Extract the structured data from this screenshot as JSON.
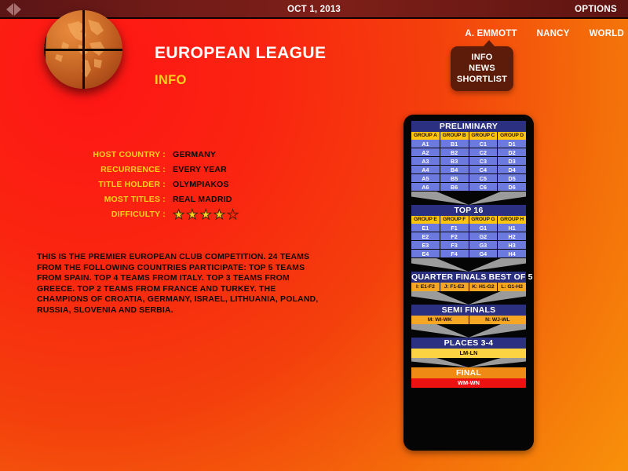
{
  "topbar": {
    "date": "OCT 1, 2013",
    "options_label": "OPTIONS",
    "back_icon": "triangle-left-icon",
    "forward_icon": "triangle-right-icon"
  },
  "logo": {
    "icon": "basketball-globe-logo"
  },
  "header": {
    "title": "EUROPEAN LEAGUE",
    "subtitle": "INFO"
  },
  "usernav": {
    "items": [
      {
        "label": "A. EMMOTT",
        "active": true
      },
      {
        "label": "NANCY",
        "active": false
      },
      {
        "label": "WORLD",
        "active": false
      }
    ]
  },
  "dropdown": {
    "items": [
      {
        "label": "INFO"
      },
      {
        "label": "NEWS"
      },
      {
        "label": "SHORTLIST"
      }
    ]
  },
  "info_fields": [
    {
      "label": "HOST COUNTRY :",
      "value": "GERMANY"
    },
    {
      "label": "RECURRENCE :",
      "value": "EVERY YEAR"
    },
    {
      "label": "TITLE HOLDER :",
      "value": "OLYMPIAKOS"
    },
    {
      "label": "MOST TITLES :",
      "value": "REAL MADRID"
    }
  ],
  "difficulty": {
    "label": "DIFFICULTY :",
    "filled": 4,
    "total": 5,
    "filled_glyph": "★",
    "empty_glyph": "★"
  },
  "description": "THIS IS THE PREMIER EUROPEAN CLUB COMPETITION.  24 TEAMS FROM THE FOLLOWING COUNTRIES PARTICIPATE: TOP 5 TEAMS FROM SPAIN.  TOP 4 TEAMS FROM ITALY.  TOP 3 TEAMS FROM GREECE.  TOP 2 TEAMS FROM FRANCE AND TURKEY.  THE CHAMPIONS OF CROATIA, GERMANY, ISRAEL, LITHUANIA, POLAND, RUSSIA, SLOVENIA AND SERBIA.",
  "bracket": {
    "preliminary": {
      "title": "PRELIMINARY",
      "group_headers": [
        "GROUP A",
        "GROUP B",
        "GROUP C",
        "GROUP D"
      ],
      "rows": [
        [
          "A1",
          "B1",
          "C1",
          "D1"
        ],
        [
          "A2",
          "B2",
          "C2",
          "D2"
        ],
        [
          "A3",
          "B3",
          "C3",
          "D3"
        ],
        [
          "A4",
          "B4",
          "C4",
          "D4"
        ],
        [
          "A5",
          "B5",
          "C5",
          "D5"
        ],
        [
          "A6",
          "B6",
          "C6",
          "D6"
        ]
      ]
    },
    "top16": {
      "title": "TOP 16",
      "group_headers": [
        "GROUP E",
        "GROUP F",
        "GROUP G",
        "GROUP H"
      ],
      "rows": [
        [
          "E1",
          "F1",
          "G1",
          "H1"
        ],
        [
          "E2",
          "F2",
          "G2",
          "H2"
        ],
        [
          "E3",
          "F3",
          "G3",
          "H3"
        ],
        [
          "E4",
          "F4",
          "G4",
          "H4"
        ]
      ]
    },
    "quarter_finals": {
      "title": "QUARTER FINALS BEST OF 5",
      "matches": [
        "I: E1-F2",
        "J: F1-E2",
        "K: H1-G2",
        "L: G1-H2"
      ]
    },
    "semi_finals": {
      "title": "SEMI FINALS",
      "matches": [
        "M: WI-WK",
        "N: WJ-WL"
      ]
    },
    "places34": {
      "title": "PLACES 3-4",
      "match": "LM-LN"
    },
    "final": {
      "title": "FINAL",
      "match": "WM-WN"
    }
  },
  "colors": {
    "bg_red": "#ff1515",
    "bg_orange": "#f8910a",
    "topbar": "#7d1f18",
    "accent_yellow": "#ffd21e",
    "stage_blue": "#2b3080",
    "group_gold": "#ffc40d",
    "cell_blue": "#6c7ae0",
    "pair_orange": "#f5a623",
    "places_yellow": "#fcd443",
    "final_red": "#ee1111",
    "final_orange": "#ef8b14",
    "panel_black": "#050505"
  }
}
